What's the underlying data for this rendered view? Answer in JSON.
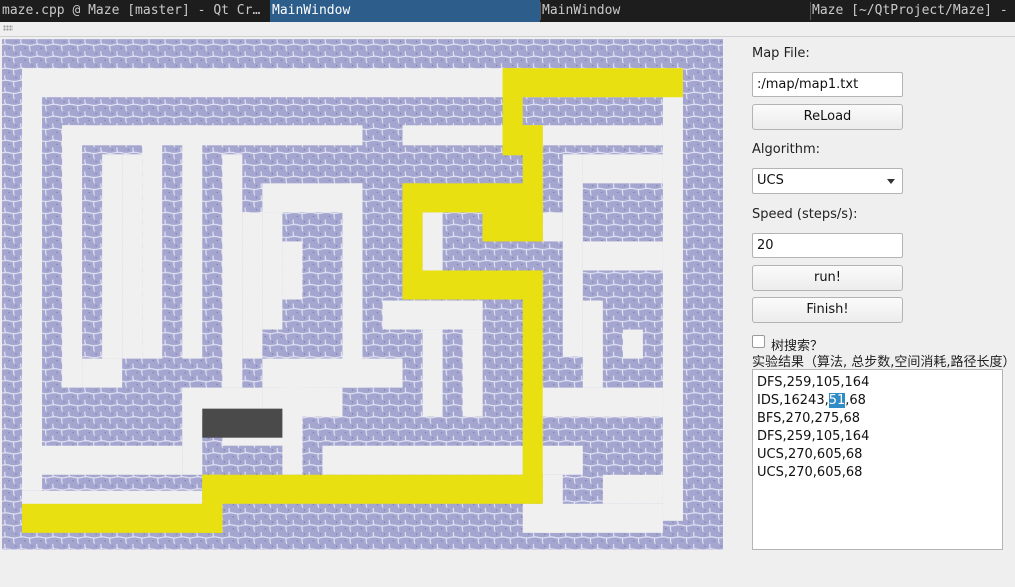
{
  "taskbar": {
    "items": [
      {
        "label": "maze.cpp @ Maze [master] - Qt Cr…",
        "active": false
      },
      {
        "label": "MainWindow",
        "active": true
      },
      {
        "label": "MainWindow",
        "active": false
      },
      {
        "label": "Maze [~/QtProject/Maze] -",
        "active": false
      }
    ],
    "active_color": "#2c5d8b"
  },
  "maze": {
    "wall_texture": "blue-gray cobblestone",
    "path_color": "#e8e010",
    "floor_color": "#f0f0f0",
    "special_cell_color": "#4a4a4a"
  },
  "panel": {
    "map_file_label": "Map File:",
    "map_file_value": ":/map/map1.txt",
    "reload_label": "ReLoad",
    "algorithm_label": "Algorithm:",
    "algorithm_value": "UCS",
    "speed_label": "Speed (steps/s):",
    "speed_value": "20",
    "run_label": "run!",
    "finish_label": "Finish!",
    "tree_search_label": "树搜索？",
    "tree_search_checked": false,
    "results_label": "实验结果（算法, 总步数,空间消耗,路径长度）",
    "results": [
      {
        "text": "DFS,259,105,164"
      },
      {
        "pre": "IDS,16243,",
        "sel": "51",
        "post": ",68"
      },
      {
        "text": "BFS,270,275,68"
      },
      {
        "text": "DFS,259,105,164"
      },
      {
        "text": "UCS,270,605,68"
      },
      {
        "text": "UCS,270,605,68"
      }
    ]
  }
}
